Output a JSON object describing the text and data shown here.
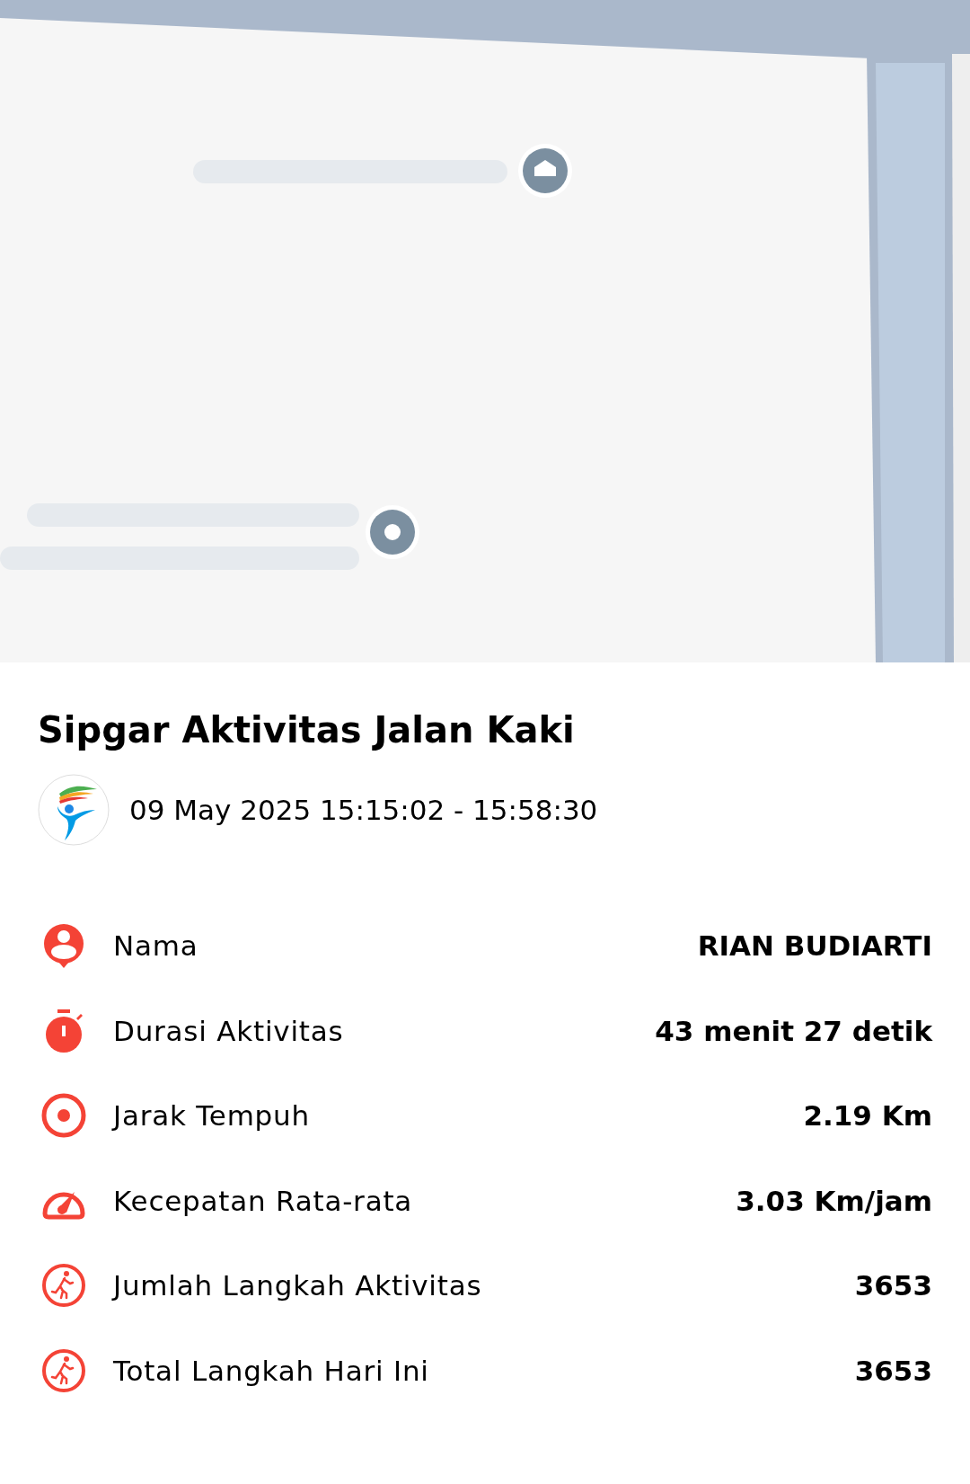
{
  "title": "Sipgar Aktivitas Jalan Kaki",
  "datetime": "09 May 2025 15:15:02 - 15:58:30",
  "rows": [
    {
      "kind": "person",
      "label": "Nama",
      "value": "RIAN BUDIARTI"
    },
    {
      "kind": "stopwatch",
      "label": "Durasi Aktivitas",
      "value": "43 menit 27 detik"
    },
    {
      "kind": "target",
      "label": "Jarak Tempuh",
      "value": "2.19 Km"
    },
    {
      "kind": "speed",
      "label": "Kecepatan Rata-rata",
      "value": "3.03 Km/jam"
    },
    {
      "kind": "walk",
      "label": "Jumlah Langkah Aktivitas",
      "value": "3653"
    },
    {
      "kind": "walk",
      "label": "Total Langkah Hari Ini",
      "value": "3653"
    }
  ]
}
